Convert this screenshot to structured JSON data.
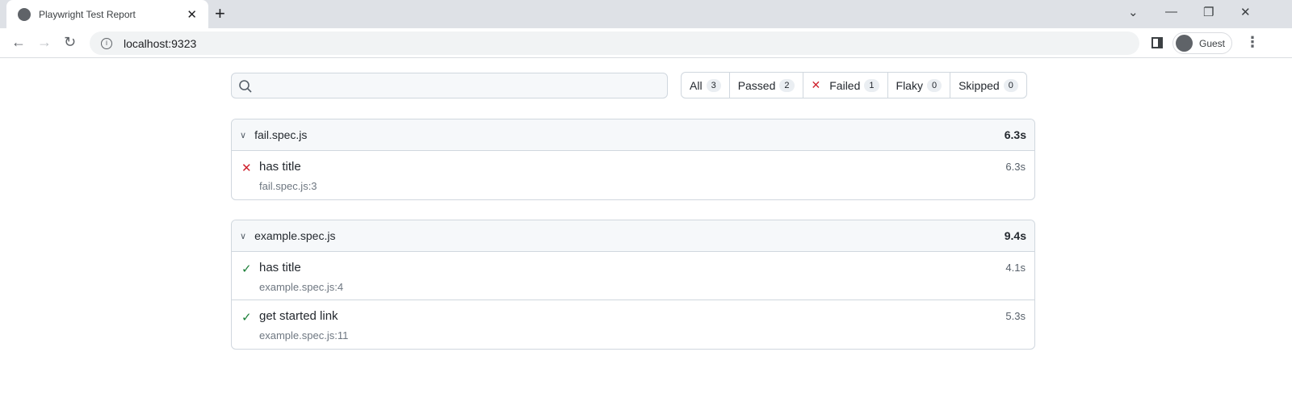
{
  "browser": {
    "tab_title": "Playwright Test Report",
    "url": "localhost:9323",
    "profile": "Guest"
  },
  "filters": [
    {
      "label": "All",
      "count": "3"
    },
    {
      "label": "Passed",
      "count": "2"
    },
    {
      "label": "Failed",
      "count": "1",
      "icon": "x"
    },
    {
      "label": "Flaky",
      "count": "0"
    },
    {
      "label": "Skipped",
      "count": "0"
    }
  ],
  "search": {
    "value": "",
    "placeholder": ""
  },
  "groups": [
    {
      "file": "fail.spec.js",
      "duration": "6.3s",
      "tests": [
        {
          "status": "failed",
          "title": "has title",
          "location": "fail.spec.js:3",
          "duration": "6.3s"
        }
      ]
    },
    {
      "file": "example.spec.js",
      "duration": "9.4s",
      "tests": [
        {
          "status": "passed",
          "title": "has title",
          "location": "example.spec.js:4",
          "duration": "4.1s"
        },
        {
          "status": "passed",
          "title": "get started link",
          "location": "example.spec.js:11",
          "duration": "5.3s"
        }
      ]
    }
  ],
  "colors": {
    "failed": "#cf222e",
    "passed": "#1a7f37"
  }
}
